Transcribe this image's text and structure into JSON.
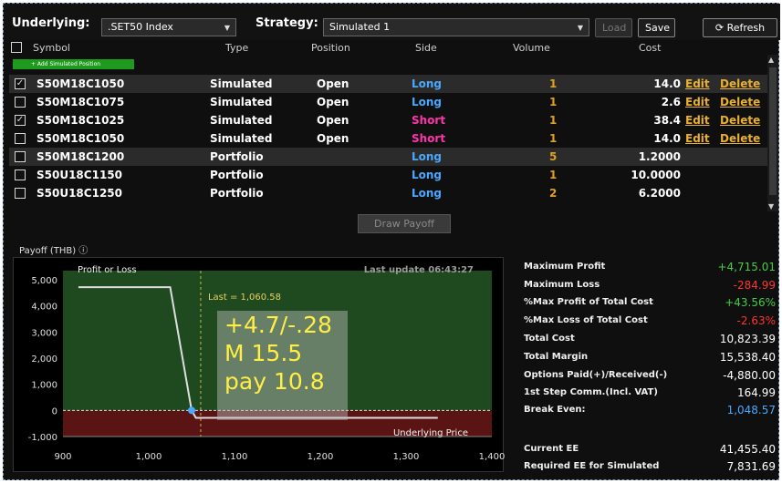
{
  "toolbar": {
    "underlying_label": "Underlying:",
    "underlying_value": ".SET50 Index",
    "strategy_label": "Strategy:",
    "strategy_value": "Simulated 1",
    "load_label": "Load",
    "save_label": "Save",
    "refresh_label": "Refresh"
  },
  "table": {
    "headers": [
      "Symbol",
      "Type",
      "Position",
      "Side",
      "Volume",
      "Cost"
    ],
    "add_button": "+ Add Simulated Position",
    "rows": [
      {
        "checked": true,
        "symbol": "S50M18C1050",
        "type": "Simulated",
        "position": "Open",
        "side": "Long",
        "volume": "1",
        "cost": "14.0",
        "edit": "Edit",
        "delete": "Delete",
        "selected": true
      },
      {
        "checked": false,
        "symbol": "S50M18C1075",
        "type": "Simulated",
        "position": "Open",
        "side": "Long",
        "volume": "1",
        "cost": "2.6",
        "edit": "Edit",
        "delete": "Delete"
      },
      {
        "checked": true,
        "symbol": "S50M18C1025",
        "type": "Simulated",
        "position": "Open",
        "side": "Short",
        "volume": "1",
        "cost": "38.4",
        "edit": "Edit",
        "delete": "Delete"
      },
      {
        "checked": false,
        "symbol": "S50M18C1050",
        "type": "Simulated",
        "position": "Open",
        "side": "Short",
        "volume": "1",
        "cost": "14.0",
        "edit": "Edit",
        "delete": "Delete"
      },
      {
        "checked": false,
        "symbol": "S50M18C1200",
        "type": "Portfolio",
        "position": "",
        "side": "Long",
        "volume": "5",
        "cost": "1.2000",
        "selected": true
      },
      {
        "checked": false,
        "symbol": "S50U18C1150",
        "type": "Portfolio",
        "position": "",
        "side": "Long",
        "volume": "1",
        "cost": "10.0000"
      },
      {
        "checked": false,
        "symbol": "S50U18C1250",
        "type": "Portfolio",
        "position": "",
        "side": "Long",
        "volume": "2",
        "cost": "6.2000"
      }
    ],
    "draw_payoff_label": "Draw Payoff"
  },
  "payoff": {
    "title": "Payoff (THB)",
    "info_icon": "info-icon",
    "chart_label": "Profit or Loss",
    "last_update": "Last update 06:43:27",
    "last_marker": "Last = 1,060.58",
    "x_axis_label": "Underlying Price",
    "overlay_lines": [
      "+4.7/-.28",
      "M 15.5",
      "pay 10.8"
    ]
  },
  "chart_data": {
    "type": "line",
    "xlim": [
      900,
      1400
    ],
    "ylim": [
      -1000,
      5000
    ],
    "xticks": [
      "900",
      "1,000",
      "1,100",
      "1,200",
      "1,300",
      "1,400"
    ],
    "yticks": [
      "5,000",
      "4,000",
      "3,000",
      "2,000",
      "1,000",
      "0",
      "-1,000"
    ],
    "series": [
      {
        "points": [
          [
            918,
            4715
          ],
          [
            1025,
            4715
          ],
          [
            1050,
            0
          ],
          [
            1055,
            -285
          ],
          [
            1337,
            -285
          ]
        ]
      }
    ],
    "last_price": 1060.58,
    "marker_point": [
      1050,
      0
    ],
    "colors": {
      "profit_zone": "#1f4a1f",
      "loss_zone": "#5a1414",
      "line": "#dddddd",
      "last_line": "#c8b84a",
      "marker": "#4aa8ff"
    }
  },
  "stats": [
    {
      "label": "Maximum Profit",
      "value": "+4,715.01",
      "tone": "pos"
    },
    {
      "label": "Maximum Loss",
      "value": "-284.99",
      "tone": "neg"
    },
    {
      "label": "%Max Profit of Total Cost",
      "value": "+43.56%",
      "tone": "pos"
    },
    {
      "label": "%Max Loss of Total Cost",
      "value": "-2.63%",
      "tone": "neg"
    },
    {
      "label": "Total Cost",
      "value": "10,823.39",
      "tone": ""
    },
    {
      "label": "Total Margin",
      "value": "15,538.40",
      "tone": ""
    },
    {
      "label": "Options Paid(+)/Received(-)",
      "value": "-4,880.00",
      "tone": ""
    },
    {
      "label": "1st Step Comm.(Incl. VAT)",
      "value": "164.99",
      "tone": ""
    },
    {
      "label": "Break Even:",
      "value": "1,048.57",
      "tone": "blue"
    },
    {
      "label": "Current EE",
      "value": "41,455.40",
      "tone": ""
    },
    {
      "label": "Required EE for Simulated",
      "value": "7,831.69",
      "tone": ""
    }
  ]
}
